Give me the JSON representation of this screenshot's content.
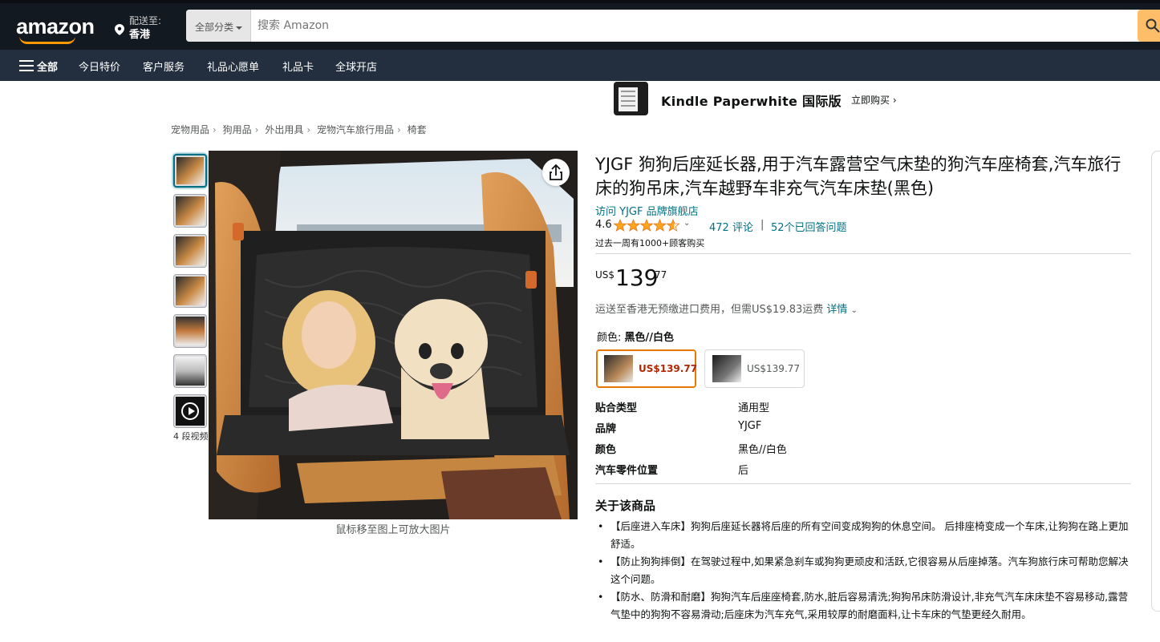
{
  "header": {
    "logo": "amazon",
    "deliver_line1": "配送至:",
    "deliver_line2": "香港",
    "search_category": "全部分类",
    "search_placeholder": "搜索 Amazon"
  },
  "nav": {
    "all": "全部",
    "items": [
      "今日特价",
      "客户服务",
      "礼品心愿单",
      "礼品卡",
      "全球开店"
    ]
  },
  "banner": {
    "title": "Kindle Paperwhite 国际版",
    "cta": "立即购买"
  },
  "breadcrumb": [
    "宠物用品",
    "狗用品",
    "外出用具",
    "宠物汽车旅行用品",
    "椅套"
  ],
  "gallery": {
    "video_count": "4 段视频",
    "zoom_hint": "鼠标移至图上可放大图片"
  },
  "product": {
    "title": "YJGF 狗狗后座延长器,用于汽车露营空气床垫的狗汽车座椅套,汽车旅行床的狗吊床,汽车越野车非充气汽车床垫(黑色)",
    "brand_link": "访问 YJGF 品牌旗舰店",
    "rating": "4.6",
    "rating_value": 4.6,
    "reviews": "472 评论",
    "separator": "|",
    "answered": "52个已回答问题",
    "bought": "过去一周有1000+顾客购买",
    "price_currency": "US$",
    "price_whole": "139",
    "price_fraction": "77",
    "shipping_text": "运送至香港无预缴进口费用，但需US$19.83运费",
    "shipping_link": "详情",
    "color_label": "颜色: ",
    "color_value": "黑色//白色",
    "variants": [
      {
        "price": "US$139.77",
        "selected": true
      },
      {
        "price": "US$139.77",
        "selected": false
      }
    ],
    "specs": [
      {
        "k": "贴合类型",
        "v": "通用型"
      },
      {
        "k": "品牌",
        "v": "YJGF"
      },
      {
        "k": "颜色",
        "v": "黑色//白色"
      },
      {
        "k": "汽车零件位置",
        "v": "后"
      }
    ],
    "about_title": "关于该商品",
    "bullets": [
      "【后座进入车床】狗狗后座延长器将后座的所有空间变成狗狗的休息空间。 后排座椅变成一个车床,让狗狗在路上更加舒适。",
      "【防止狗狗摔倒】在驾驶过程中,如果紧急刹车或狗狗更顽皮和活跃,它很容易从后座掉落。汽车狗旅行床可帮助您解决这个问题。",
      "【防水、防滑和耐磨】狗狗汽车后座座椅套,防水,脏后容易清洗;狗狗吊床防滑设计,非充气汽车床床垫不容易移动,露营气垫中的狗狗不容易滑动;后座床为汽车充气,采用较厚的耐磨面料,让卡车床的气垫更经久耐用。"
    ]
  },
  "colors": {
    "header_bg": "#131921",
    "nav_bg": "#232f3e",
    "accent": "#ff9900",
    "search_button": "#febd69",
    "link": "#007185",
    "price_red": "#b12704",
    "star": "#ffa41c"
  }
}
